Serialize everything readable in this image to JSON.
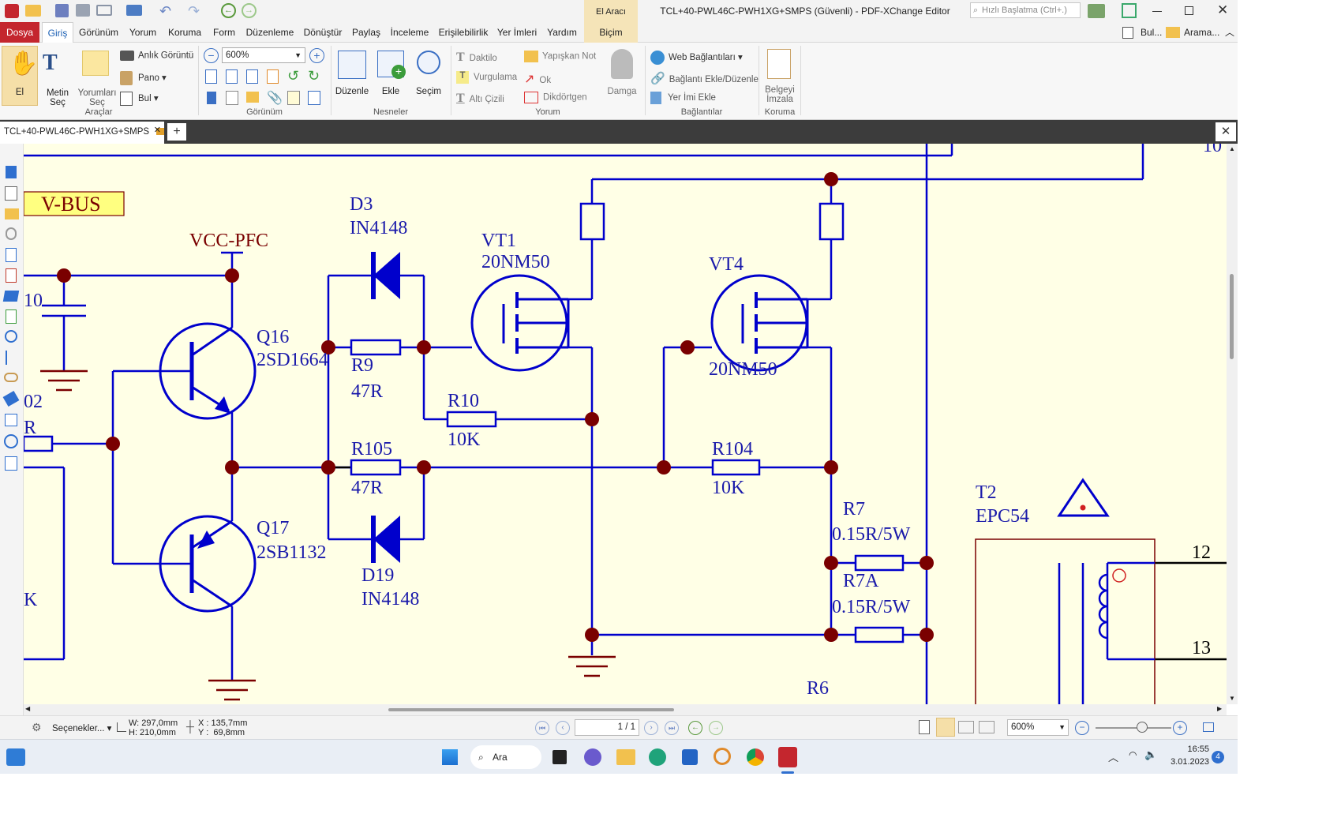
{
  "window": {
    "title": "TCL+40-PWL46C-PWH1XG+SMPS (Güvenli) - PDF-XChange Editor",
    "context_tab_group": "El Aracı",
    "quick_search_placeholder": "Hızlı Başlatma (Ctrl+.)",
    "find_label": "Bul...",
    "search_label": "Arama..."
  },
  "menu": [
    "Dosya",
    "Giriş",
    "Görünüm",
    "Yorum",
    "Koruma",
    "Form",
    "Düzenleme",
    "Dönüştür",
    "Paylaş",
    "İnceleme",
    "Erişilebilirlik",
    "Yer İmleri",
    "Yardım",
    "Biçim"
  ],
  "ribbon": {
    "tools": {
      "hand": "El",
      "select_text": "Metin Seç",
      "select_comments": "Yorumları Seç",
      "snapshot": "Anlık Görüntü",
      "clipboard": "Pano",
      "find": "Bul",
      "group": "Araçlar"
    },
    "view": {
      "zoom": "600%",
      "group": "Görünüm"
    },
    "objects": {
      "edit": "Düzenle",
      "add": "Ekle",
      "selection": "Seçim",
      "group": "Nesneler"
    },
    "comment": {
      "typewriter": "Daktilo",
      "sticky": "Yapışkan Not",
      "highlight": "Vurgulama",
      "arrow": "Ok",
      "underline": "Altı Çizili",
      "rectangle": "Dikdörtgen",
      "stamp": "Damga",
      "group": "Yorum"
    },
    "links": {
      "web": "Web Bağlantıları",
      "add_edit": "Bağlantı Ekle/Düzenle",
      "bookmark": "Yer İmi Ekle",
      "group": "Bağlantılar"
    },
    "protect": {
      "sign": "Belgeyi İmzala",
      "group": "Koruma"
    }
  },
  "document_tab": {
    "label": "TCL+40-PWL46C-PWH1XG+SMPS"
  },
  "schematic": {
    "vbus": "V-BUS",
    "vcc": "VCC-PFC",
    "d3": "D3",
    "d3_part": "IN4148",
    "vt1": "VT1",
    "vt1_part": "20NM50",
    "vt4": "VT4",
    "vt4_part": "20NM50",
    "q16": "Q16",
    "q16_part": "2SD1664",
    "q17": "Q17",
    "q17_part": "2SB1132",
    "r9": "R9",
    "r9_val": "47R",
    "r10": "R10",
    "r10_val": "10K",
    "r105": "R105",
    "r105_val": "47R",
    "r104": "R104",
    "r104_val": "10K",
    "d19": "D19",
    "d19_part": "IN4148",
    "r7": "R7",
    "r7_val": "0.15R/5W",
    "r7a": "R7A",
    "r7a_val": "0.15R/5W",
    "r6": "R6",
    "t2": "T2",
    "t2_part": "EPC54",
    "pin12": "12",
    "pin13": "13",
    "left_frag_1": "10",
    "left_frag_2": "02",
    "left_frag_3": "R",
    "left_frag_4": "K",
    "top_right_frag": "10"
  },
  "status": {
    "options": "Seçenekler...",
    "width": "W: 297,0mm",
    "height": "H: 210,0mm",
    "x": "X : 135,7mm",
    "y": "Y :  69,8mm",
    "page": "1 / 1",
    "zoom": "600%"
  },
  "taskbar": {
    "search": "Ara",
    "time": "16:55",
    "date": "3.01.2023",
    "badge": "4"
  },
  "colors": {
    "wire": "#0000cc",
    "node": "#7a0000",
    "canvas": "#ffffe6",
    "accent": "#c4262e",
    "label": "#1a1aaa"
  }
}
